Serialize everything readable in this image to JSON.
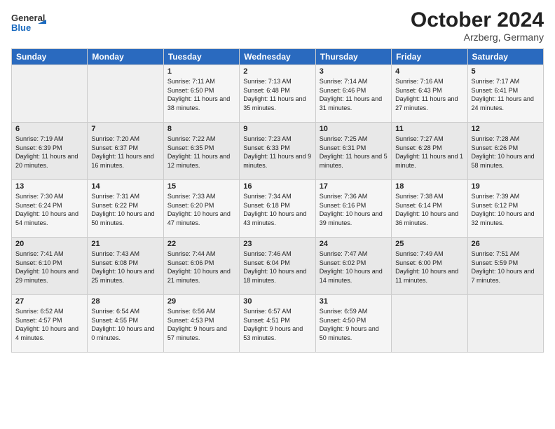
{
  "header": {
    "logo_general": "General",
    "logo_blue": "Blue",
    "month_title": "October 2024",
    "location": "Arzberg, Germany"
  },
  "days_of_week": [
    "Sunday",
    "Monday",
    "Tuesday",
    "Wednesday",
    "Thursday",
    "Friday",
    "Saturday"
  ],
  "weeks": [
    [
      {
        "day": "",
        "sunrise": "",
        "sunset": "",
        "daylight": ""
      },
      {
        "day": "",
        "sunrise": "",
        "sunset": "",
        "daylight": ""
      },
      {
        "day": "1",
        "sunrise": "Sunrise: 7:11 AM",
        "sunset": "Sunset: 6:50 PM",
        "daylight": "Daylight: 11 hours and 38 minutes."
      },
      {
        "day": "2",
        "sunrise": "Sunrise: 7:13 AM",
        "sunset": "Sunset: 6:48 PM",
        "daylight": "Daylight: 11 hours and 35 minutes."
      },
      {
        "day": "3",
        "sunrise": "Sunrise: 7:14 AM",
        "sunset": "Sunset: 6:46 PM",
        "daylight": "Daylight: 11 hours and 31 minutes."
      },
      {
        "day": "4",
        "sunrise": "Sunrise: 7:16 AM",
        "sunset": "Sunset: 6:43 PM",
        "daylight": "Daylight: 11 hours and 27 minutes."
      },
      {
        "day": "5",
        "sunrise": "Sunrise: 7:17 AM",
        "sunset": "Sunset: 6:41 PM",
        "daylight": "Daylight: 11 hours and 24 minutes."
      }
    ],
    [
      {
        "day": "6",
        "sunrise": "Sunrise: 7:19 AM",
        "sunset": "Sunset: 6:39 PM",
        "daylight": "Daylight: 11 hours and 20 minutes."
      },
      {
        "day": "7",
        "sunrise": "Sunrise: 7:20 AM",
        "sunset": "Sunset: 6:37 PM",
        "daylight": "Daylight: 11 hours and 16 minutes."
      },
      {
        "day": "8",
        "sunrise": "Sunrise: 7:22 AM",
        "sunset": "Sunset: 6:35 PM",
        "daylight": "Daylight: 11 hours and 12 minutes."
      },
      {
        "day": "9",
        "sunrise": "Sunrise: 7:23 AM",
        "sunset": "Sunset: 6:33 PM",
        "daylight": "Daylight: 11 hours and 9 minutes."
      },
      {
        "day": "10",
        "sunrise": "Sunrise: 7:25 AM",
        "sunset": "Sunset: 6:31 PM",
        "daylight": "Daylight: 11 hours and 5 minutes."
      },
      {
        "day": "11",
        "sunrise": "Sunrise: 7:27 AM",
        "sunset": "Sunset: 6:28 PM",
        "daylight": "Daylight: 11 hours and 1 minute."
      },
      {
        "day": "12",
        "sunrise": "Sunrise: 7:28 AM",
        "sunset": "Sunset: 6:26 PM",
        "daylight": "Daylight: 10 hours and 58 minutes."
      }
    ],
    [
      {
        "day": "13",
        "sunrise": "Sunrise: 7:30 AM",
        "sunset": "Sunset: 6:24 PM",
        "daylight": "Daylight: 10 hours and 54 minutes."
      },
      {
        "day": "14",
        "sunrise": "Sunrise: 7:31 AM",
        "sunset": "Sunset: 6:22 PM",
        "daylight": "Daylight: 10 hours and 50 minutes."
      },
      {
        "day": "15",
        "sunrise": "Sunrise: 7:33 AM",
        "sunset": "Sunset: 6:20 PM",
        "daylight": "Daylight: 10 hours and 47 minutes."
      },
      {
        "day": "16",
        "sunrise": "Sunrise: 7:34 AM",
        "sunset": "Sunset: 6:18 PM",
        "daylight": "Daylight: 10 hours and 43 minutes."
      },
      {
        "day": "17",
        "sunrise": "Sunrise: 7:36 AM",
        "sunset": "Sunset: 6:16 PM",
        "daylight": "Daylight: 10 hours and 39 minutes."
      },
      {
        "day": "18",
        "sunrise": "Sunrise: 7:38 AM",
        "sunset": "Sunset: 6:14 PM",
        "daylight": "Daylight: 10 hours and 36 minutes."
      },
      {
        "day": "19",
        "sunrise": "Sunrise: 7:39 AM",
        "sunset": "Sunset: 6:12 PM",
        "daylight": "Daylight: 10 hours and 32 minutes."
      }
    ],
    [
      {
        "day": "20",
        "sunrise": "Sunrise: 7:41 AM",
        "sunset": "Sunset: 6:10 PM",
        "daylight": "Daylight: 10 hours and 29 minutes."
      },
      {
        "day": "21",
        "sunrise": "Sunrise: 7:43 AM",
        "sunset": "Sunset: 6:08 PM",
        "daylight": "Daylight: 10 hours and 25 minutes."
      },
      {
        "day": "22",
        "sunrise": "Sunrise: 7:44 AM",
        "sunset": "Sunset: 6:06 PM",
        "daylight": "Daylight: 10 hours and 21 minutes."
      },
      {
        "day": "23",
        "sunrise": "Sunrise: 7:46 AM",
        "sunset": "Sunset: 6:04 PM",
        "daylight": "Daylight: 10 hours and 18 minutes."
      },
      {
        "day": "24",
        "sunrise": "Sunrise: 7:47 AM",
        "sunset": "Sunset: 6:02 PM",
        "daylight": "Daylight: 10 hours and 14 minutes."
      },
      {
        "day": "25",
        "sunrise": "Sunrise: 7:49 AM",
        "sunset": "Sunset: 6:00 PM",
        "daylight": "Daylight: 10 hours and 11 minutes."
      },
      {
        "day": "26",
        "sunrise": "Sunrise: 7:51 AM",
        "sunset": "Sunset: 5:59 PM",
        "daylight": "Daylight: 10 hours and 7 minutes."
      }
    ],
    [
      {
        "day": "27",
        "sunrise": "Sunrise: 6:52 AM",
        "sunset": "Sunset: 4:57 PM",
        "daylight": "Daylight: 10 hours and 4 minutes."
      },
      {
        "day": "28",
        "sunrise": "Sunrise: 6:54 AM",
        "sunset": "Sunset: 4:55 PM",
        "daylight": "Daylight: 10 hours and 0 minutes."
      },
      {
        "day": "29",
        "sunrise": "Sunrise: 6:56 AM",
        "sunset": "Sunset: 4:53 PM",
        "daylight": "Daylight: 9 hours and 57 minutes."
      },
      {
        "day": "30",
        "sunrise": "Sunrise: 6:57 AM",
        "sunset": "Sunset: 4:51 PM",
        "daylight": "Daylight: 9 hours and 53 minutes."
      },
      {
        "day": "31",
        "sunrise": "Sunrise: 6:59 AM",
        "sunset": "Sunset: 4:50 PM",
        "daylight": "Daylight: 9 hours and 50 minutes."
      },
      {
        "day": "",
        "sunrise": "",
        "sunset": "",
        "daylight": ""
      },
      {
        "day": "",
        "sunrise": "",
        "sunset": "",
        "daylight": ""
      }
    ]
  ]
}
